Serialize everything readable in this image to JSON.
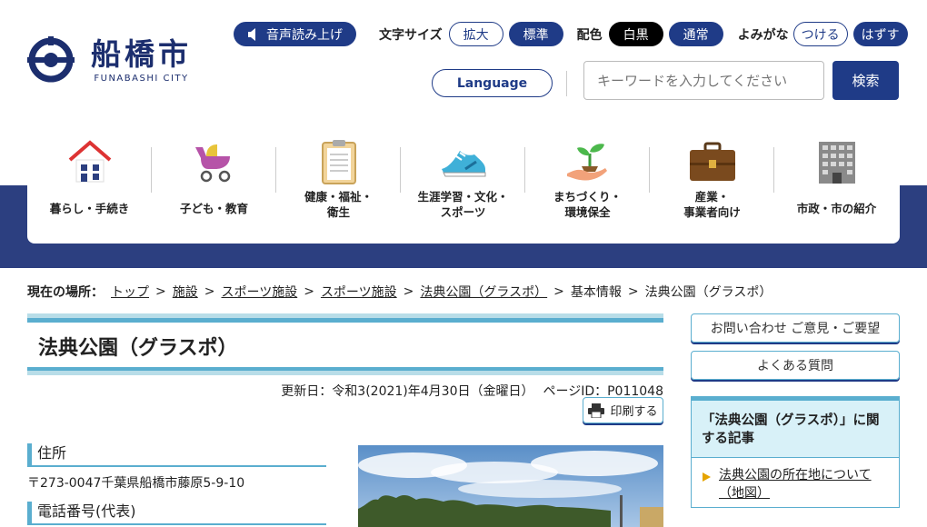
{
  "header": {
    "logo_text": "船橋市",
    "logo_sub": "FUNABASHI CITY",
    "speech_label": "音声読み上げ",
    "font_size_label": "文字サイズ",
    "font_size_options": [
      "拡大",
      "標準"
    ],
    "color_label": "配色",
    "color_options": [
      "白黒",
      "通常"
    ],
    "yomigana_label": "よみがな",
    "yomigana_options": [
      "つける",
      "はずす"
    ],
    "language_label": "Language",
    "search_placeholder": "キーワードを入力してください",
    "search_button": "検索"
  },
  "nav": [
    {
      "label": "暮らし・手続き",
      "icon": "house-icon"
    },
    {
      "label": "子ども・教育",
      "icon": "stroller-icon"
    },
    {
      "label": "健康・福祉・\n衛生",
      "icon": "clipboard-icon"
    },
    {
      "label": "生涯学習・文化・\nスポーツ",
      "icon": "sneaker-icon"
    },
    {
      "label": "まちづくり・\n環境保全",
      "icon": "sprout-hand-icon"
    },
    {
      "label": "産業・\n事業者向け",
      "icon": "briefcase-icon"
    },
    {
      "label": "市政・市の紹介",
      "icon": "building-icon"
    }
  ],
  "breadcrumb": {
    "label": "現在の場所：",
    "items": [
      "トップ",
      "施設",
      "スポーツ施設",
      "スポーツ施設",
      "法典公園（グラスポ）"
    ],
    "plain": [
      "基本情報",
      "法典公園（グラスポ）"
    ]
  },
  "page": {
    "title": "法典公園（グラスポ）",
    "updated": "更新日：令和3(2021)年4月30日（金曜日）",
    "page_id": "ページID：P011048",
    "print_label": "印刷する",
    "address_heading": "住所",
    "address": "〒273-0047千葉県船橋市藤原5-9-10",
    "phone_heading": "電話番号(代表)"
  },
  "sidebar": {
    "contact_label": "お問い合わせ ご意見・ご要望",
    "faq_label": "よくある質問",
    "related_heading": "「法典公園（グラスポ）」に関する記事",
    "related_items": [
      "法典公園の所在地について（地図）"
    ]
  },
  "colors": {
    "navy": "#1f3b87",
    "band": "#2c3f80",
    "accent": "#5aaecf"
  }
}
